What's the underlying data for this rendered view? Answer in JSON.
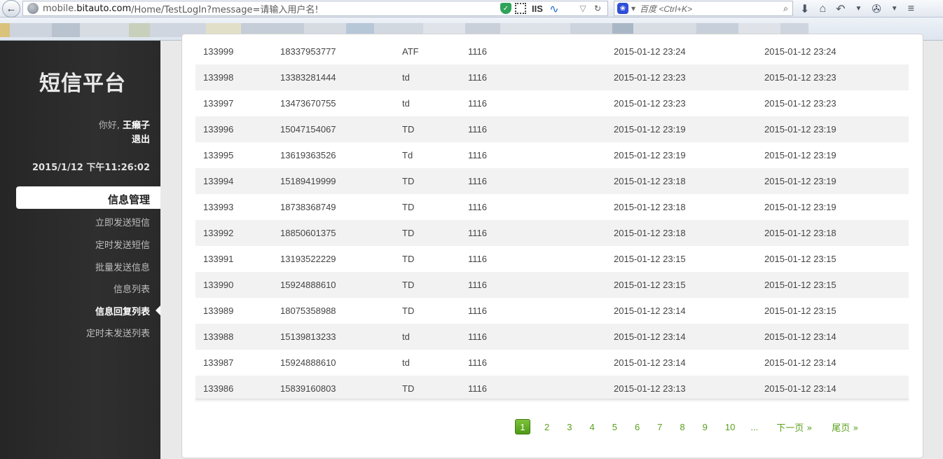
{
  "browser": {
    "url_prefix": "mobile.",
    "url_host": "bitauto.com",
    "url_path": "/Home/TestLogIn?message=请输入用户名!",
    "search_placeholder": "百度 <Ctrl+K>"
  },
  "sidebar": {
    "brand": "短信平台",
    "greeting_prefix": "你好,",
    "username": "王癞子",
    "logout": "退出",
    "datetime": "2015/1/12 下午11:26:02",
    "section_title": "信息管理",
    "items": [
      {
        "label": "立即发送短信"
      },
      {
        "label": "定时发送短信"
      },
      {
        "label": "批量发送信息"
      },
      {
        "label": "信息列表"
      },
      {
        "label": "信息回复列表"
      },
      {
        "label": "定时未发送列表"
      }
    ]
  },
  "table": {
    "rows": [
      [
        "133999",
        "18337953777",
        "ATF",
        "1116",
        "2015-01-12 23:24",
        "2015-01-12 23:24"
      ],
      [
        "133998",
        "13383281444",
        "td",
        "1116",
        "2015-01-12 23:23",
        "2015-01-12 23:23"
      ],
      [
        "133997",
        "13473670755",
        "td",
        "1116",
        "2015-01-12 23:23",
        "2015-01-12 23:23"
      ],
      [
        "133996",
        "15047154067",
        "TD",
        "1116",
        "2015-01-12 23:19",
        "2015-01-12 23:19"
      ],
      [
        "133995",
        "13619363526",
        "Td",
        "1116",
        "2015-01-12 23:19",
        "2015-01-12 23:19"
      ],
      [
        "133994",
        "15189419999",
        "TD",
        "1116",
        "2015-01-12 23:18",
        "2015-01-12 23:19"
      ],
      [
        "133993",
        "18738368749",
        "TD",
        "1116",
        "2015-01-12 23:18",
        "2015-01-12 23:19"
      ],
      [
        "133992",
        "18850601375",
        "TD",
        "1116",
        "2015-01-12 23:18",
        "2015-01-12 23:18"
      ],
      [
        "133991",
        "13193522229",
        "TD",
        "1116",
        "2015-01-12 23:15",
        "2015-01-12 23:15"
      ],
      [
        "133990",
        "15924888610",
        "TD",
        "1116",
        "2015-01-12 23:15",
        "2015-01-12 23:15"
      ],
      [
        "133989",
        "18075358988",
        "TD",
        "1116",
        "2015-01-12 23:14",
        "2015-01-12 23:15"
      ],
      [
        "133988",
        "15139813233",
        "td",
        "1116",
        "2015-01-12 23:14",
        "2015-01-12 23:14"
      ],
      [
        "133987",
        "15924888610",
        "td",
        "1116",
        "2015-01-12 23:14",
        "2015-01-12 23:14"
      ],
      [
        "133986",
        "15839160803",
        "TD",
        "1116",
        "2015-01-12 23:13",
        "2015-01-12 23:14"
      ]
    ]
  },
  "pagination": {
    "pages": [
      "1",
      "2",
      "3",
      "4",
      "5",
      "6",
      "7",
      "8",
      "9",
      "10"
    ],
    "current": "1",
    "ellipsis": "...",
    "next": "下一页 »",
    "last": "尾页 »"
  },
  "colors": {
    "accent_green": "#5aa11d",
    "sidebar_bg": "#2b2b2b"
  }
}
